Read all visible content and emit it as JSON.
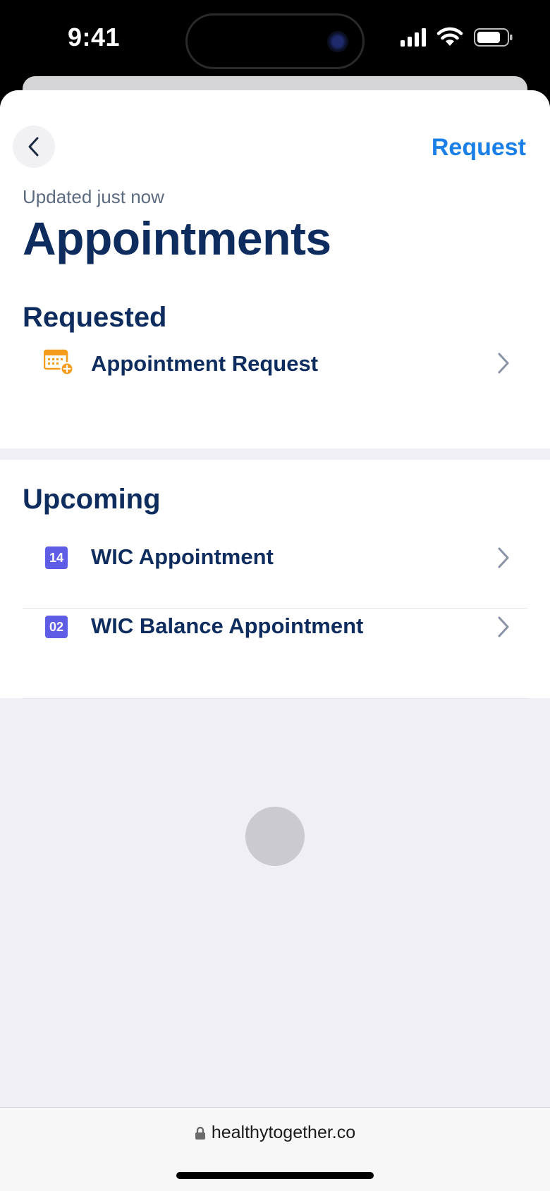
{
  "status_bar": {
    "time": "9:41",
    "signal_icon": "cellular-signal-icon",
    "wifi_icon": "wifi-icon",
    "battery_icon": "battery-icon"
  },
  "header": {
    "back_icon": "chevron-left-icon",
    "request_label": "Request",
    "updated_text": "Updated just now",
    "title": "Appointments"
  },
  "requested": {
    "heading": "Requested",
    "items": [
      {
        "label": "Appointment Request",
        "icon": "calendar-add-icon"
      }
    ]
  },
  "upcoming": {
    "heading": "Upcoming",
    "items": [
      {
        "day": "14",
        "label": "WIC Appointment"
      },
      {
        "day": "02",
        "label": "WIC Balance Appointment"
      }
    ]
  },
  "browser": {
    "url": "healthytogether.co",
    "lock_icon": "lock-icon"
  },
  "colors": {
    "accent": "#1a7fe6",
    "title": "#0e2d5e",
    "calendar_badge": "#5f5ce6",
    "request_icon": "#f59b1c",
    "background": "#efeff4"
  }
}
